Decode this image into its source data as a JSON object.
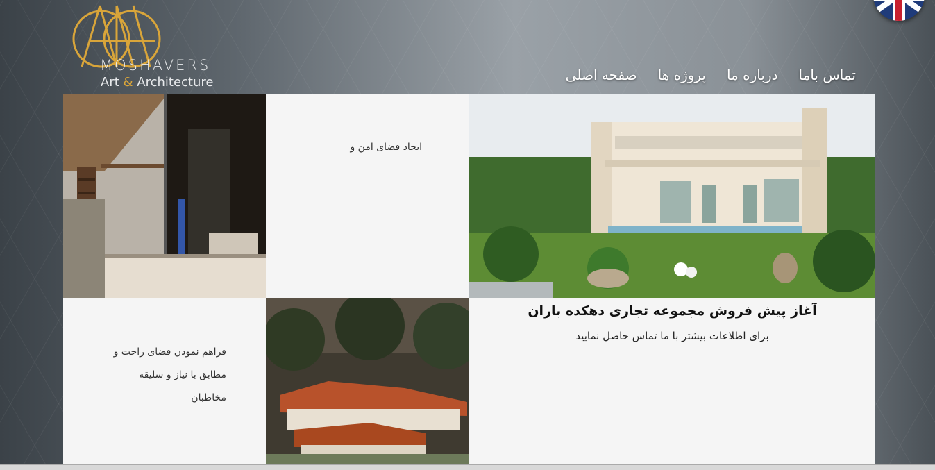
{
  "logo": {
    "monogram": "AMA",
    "name": "MOSHAVERS",
    "tagline_start": "Art ",
    "tagline_amp": "&",
    "tagline_end": " Architecture",
    "accent_color": "#d9a53a"
  },
  "language_switch": {
    "icon": "uk-flag-icon"
  },
  "nav": {
    "items": [
      "صفحه اصلی",
      "پروژه ها",
      "درباره ما",
      "تماس باما"
    ]
  },
  "tiles": {
    "text1": "ایجاد فضای امن و",
    "text2_lines": [
      "فراهم نمودن فضای راحت و",
      "مطابق با نیاز و سلیقه",
      "مخاطبان"
    ],
    "news_title": "آغاز پیش فروش مجموعه تجاری دهکده باران",
    "news_subtitle": "برای اطلاعات بیشتر با ما تماس حاصل نمایید"
  }
}
